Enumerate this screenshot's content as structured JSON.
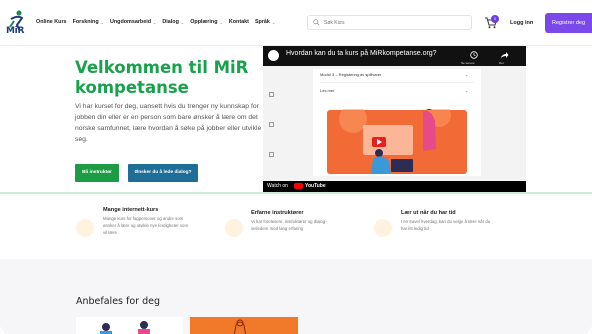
{
  "header": {
    "logo_text": "MiR",
    "nav": [
      {
        "label": "Online Kurs",
        "dropdown": false
      },
      {
        "label": "Forskning",
        "dropdown": true
      },
      {
        "label": "Ungdomsarbeid",
        "dropdown": true
      },
      {
        "label": "Dialog",
        "dropdown": true
      },
      {
        "label": "Opplæring",
        "dropdown": true
      },
      {
        "label": "Kontakt",
        "dropdown": false
      },
      {
        "label": "Språk",
        "dropdown": true
      }
    ],
    "search_placeholder": "Søk Kurs",
    "cart_count": "0",
    "login": "Logg inn",
    "register": "Registrer deg"
  },
  "hero": {
    "title": "Velkommen til MiR kompetanse",
    "text": "Vi har kurset for deg, uansett hvis du trenger ny kunnskap for jobben din eller er en person som bare ønsker å lære om det norske samfunnet, lære hvordan å søke på jobber eller utvikle seg.",
    "btn_primary": "Bli instruktør",
    "btn_secondary": "Ønsker du å lede dialog?"
  },
  "video": {
    "title": "Hvordan kan du ta kurs på MiRkompetanse.org?",
    "watch_later": "Se senere",
    "share": "Del",
    "module": "Modul 3 – Registering av spillvarer",
    "les_mer": "Les mer",
    "watch_on": "Watch on",
    "youtube": "YouTube"
  },
  "features": [
    {
      "title": "Mange internett-kurs",
      "text": "Mange kurs for fagpersoner og andre som ønsker å lære og utvikle nye ferdigheter som vil lære"
    },
    {
      "title": "Erfarne instruktører",
      "text": "Vi har forelesere, instruktører og dialog-veiledere med lang erfaring"
    },
    {
      "title": "Lær ut når du har tid",
      "text": "I en travel hverdag, kan du velge å lære når du har litt ledig tid"
    }
  ],
  "recommended": {
    "title": "Anbefales for deg"
  },
  "colors": {
    "green": "#18a24c",
    "purple": "#7b49ea",
    "blue": "#1e6e98",
    "orange": "#f07a2a"
  }
}
